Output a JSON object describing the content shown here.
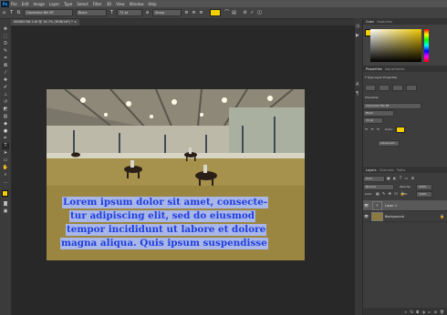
{
  "app": {
    "logo": "Ps"
  },
  "menu": [
    "File",
    "Edit",
    "Image",
    "Layer",
    "Type",
    "Select",
    "Filter",
    "3D",
    "View",
    "Window",
    "Help"
  ],
  "options": {
    "font_family": "Clarendon Blk BT",
    "font_style": "Black",
    "font_size": "72 pt",
    "antialias": "Sharp",
    "text_color": "#f5d000"
  },
  "document": {
    "tab_title": "0B5N0746 2.tif @ 16.7% (RGB/16*) *"
  },
  "tools": [
    "move-icon",
    "marquee-icon",
    "lasso-icon",
    "quick-select-icon",
    "crop-icon",
    "frame-icon",
    "eyedropper-icon",
    "healing-icon",
    "brush-icon",
    "stamp-icon",
    "history-brush-icon",
    "eraser-icon",
    "gradient-icon",
    "blur-icon",
    "dodge-icon",
    "pen-icon",
    "type-icon",
    "path-select-icon",
    "shape-icon",
    "hand-icon",
    "zoom-icon",
    "more-icon",
    "fg-bg-color-icon",
    "quick-mask-icon",
    "screen-mode-icon"
  ],
  "text_layer": {
    "lines": [
      "Lorem ipsum dolor sit amet, consecte-",
      "tur adipiscing elit, sed do eiusmod",
      "tempor incididunt ut labore et dolore",
      "magna aliqua. Quis ipsum suspendisse"
    ],
    "color": "#1f3fe0",
    "highlight": "#a9b6e8"
  },
  "color_panel": {
    "tabs": [
      "Color",
      "Swatches"
    ],
    "foreground": "#f5d000"
  },
  "properties": {
    "tabs": [
      "Properties",
      "Adjustments"
    ],
    "section": "Type Layer Properties",
    "character_label": "Character",
    "font_family": "Clarendon Blk BT",
    "font_style": "Black",
    "font_size": "72 pt",
    "color_label": "Color:",
    "advanced": "Advanced..."
  },
  "layers": {
    "tabs": [
      "Layers",
      "Channels",
      "Paths"
    ],
    "filter_label": "Kind",
    "blend_mode": "Normal",
    "opacity_label": "Opacity:",
    "opacity_value": "100%",
    "lock_label": "Lock:",
    "fill_label": "Fill:",
    "fill_value": "100%",
    "items": [
      {
        "name": "Layer 1",
        "kind": "text"
      },
      {
        "name": "Background",
        "kind": "image",
        "locked": true
      }
    ]
  }
}
